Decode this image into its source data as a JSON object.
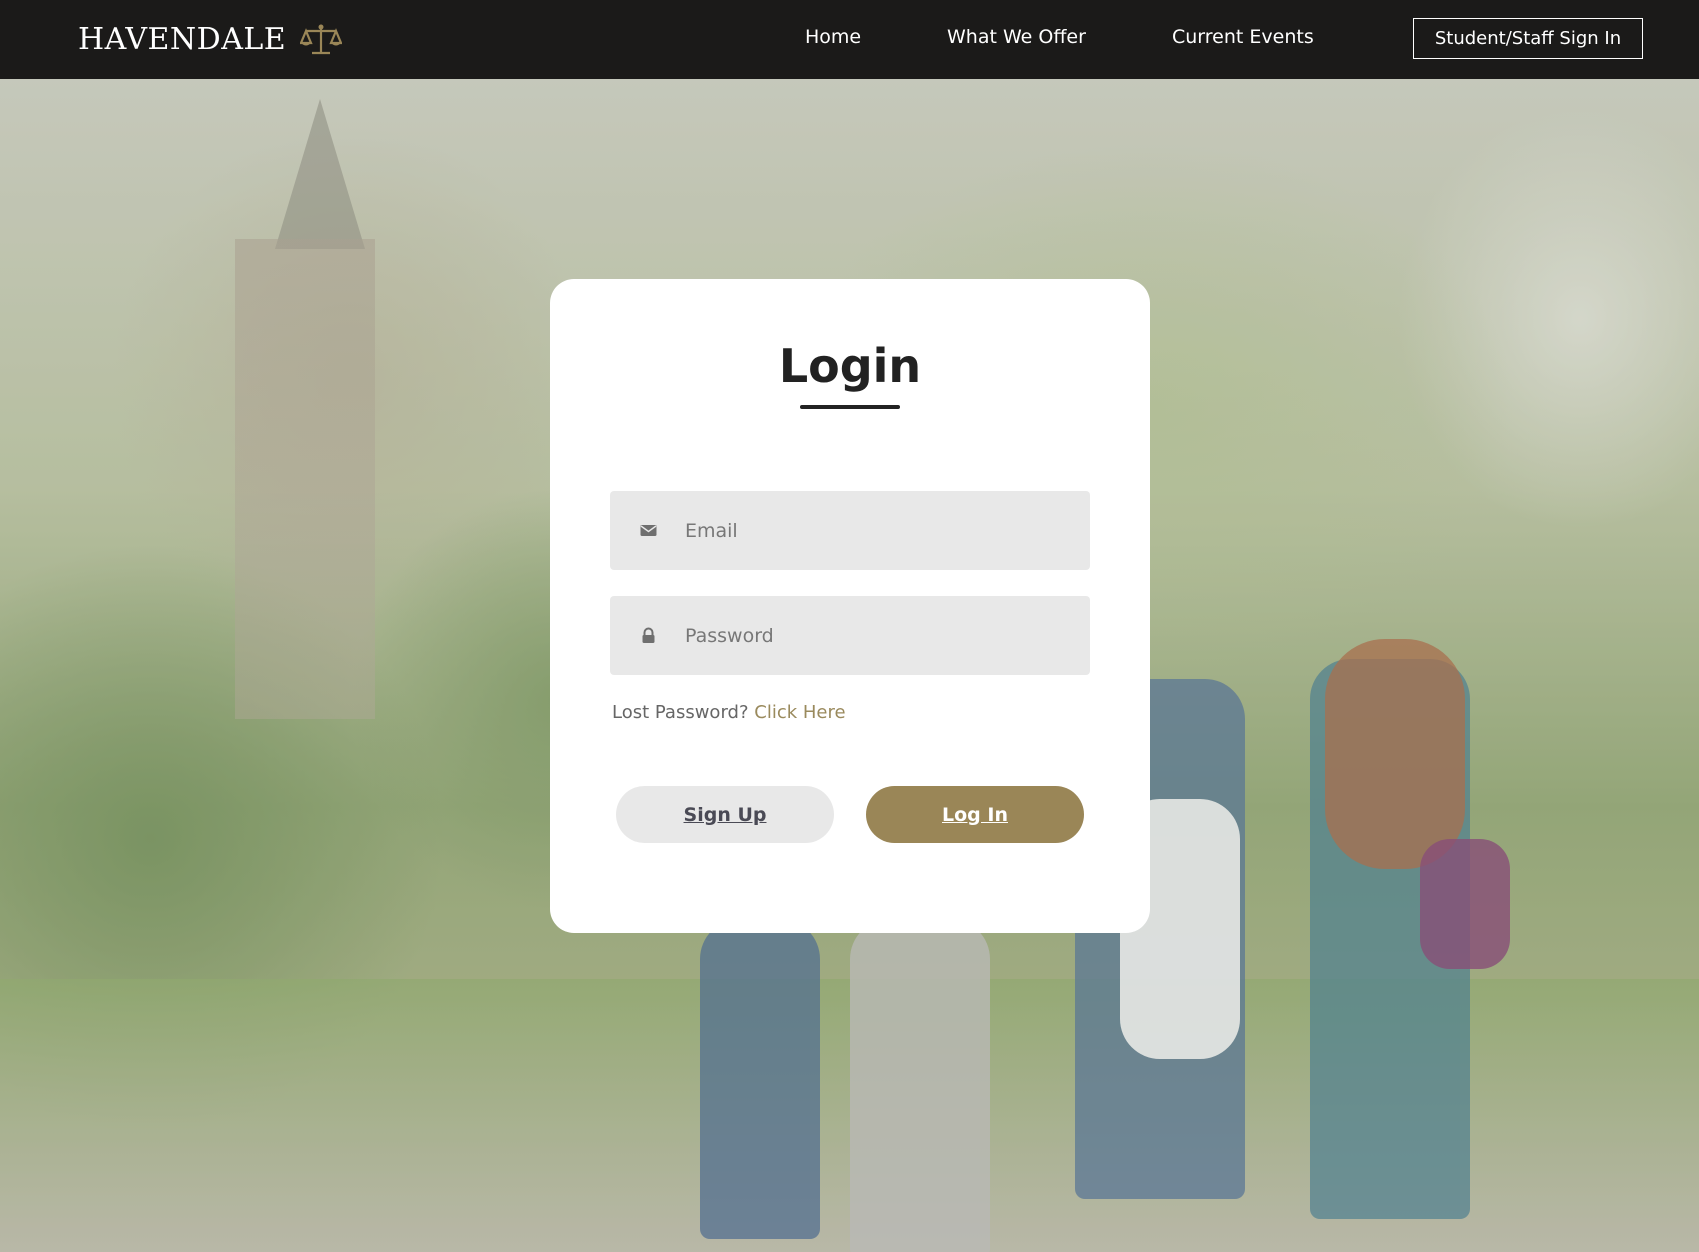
{
  "brand": {
    "name": "HAVENDALE",
    "icon": "scales-icon",
    "accent_color": "#9a8657"
  },
  "nav": {
    "links": [
      {
        "label": "Home"
      },
      {
        "label": "What We Offer"
      },
      {
        "label": "Current Events"
      }
    ],
    "signin_label": "Student/Staff Sign In"
  },
  "login": {
    "title": "Login",
    "email": {
      "placeholder": "Email",
      "value": "",
      "icon": "envelope-icon"
    },
    "password": {
      "placeholder": "Password",
      "value": "",
      "icon": "lock-icon"
    },
    "lost_password_text": "Lost Password?",
    "lost_password_link": "Click Here",
    "signup_label": "Sign Up",
    "login_label": "Log In"
  },
  "colors": {
    "navbar": "#1b1a19",
    "login_button": "#9a8657",
    "link": "#9a8a5d",
    "field_bg": "#e8e8e8"
  }
}
